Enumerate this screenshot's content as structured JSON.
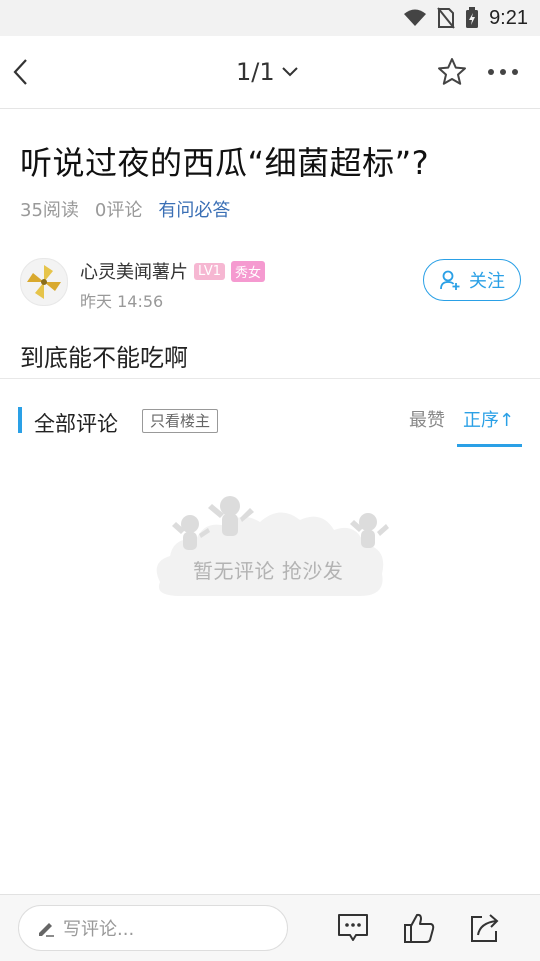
{
  "status_bar": {
    "time": "9:21"
  },
  "header": {
    "page_indicator": "1/1"
  },
  "post": {
    "title": "听说过夜的西瓜“细菌超标”?",
    "reads": "35阅读",
    "comments": "0评论",
    "category": "有问必答",
    "body": "到底能不能吃啊"
  },
  "author": {
    "name": "心灵美闻薯片",
    "level": "LV1",
    "gender_badge": "秀女",
    "time": "昨天 14:56",
    "follow_label": "关注"
  },
  "comments_section": {
    "title": "全部评论",
    "only_op": "只看楼主",
    "sort_top": "最赞",
    "sort_order": "正序↑",
    "empty_text": "暂无评论 抢沙发"
  },
  "bottom": {
    "input_placeholder": "写评论..."
  },
  "colors": {
    "accent": "#2aa0e6",
    "category_link": "#3a6fb5",
    "badge_pink": "#f59ad0"
  }
}
